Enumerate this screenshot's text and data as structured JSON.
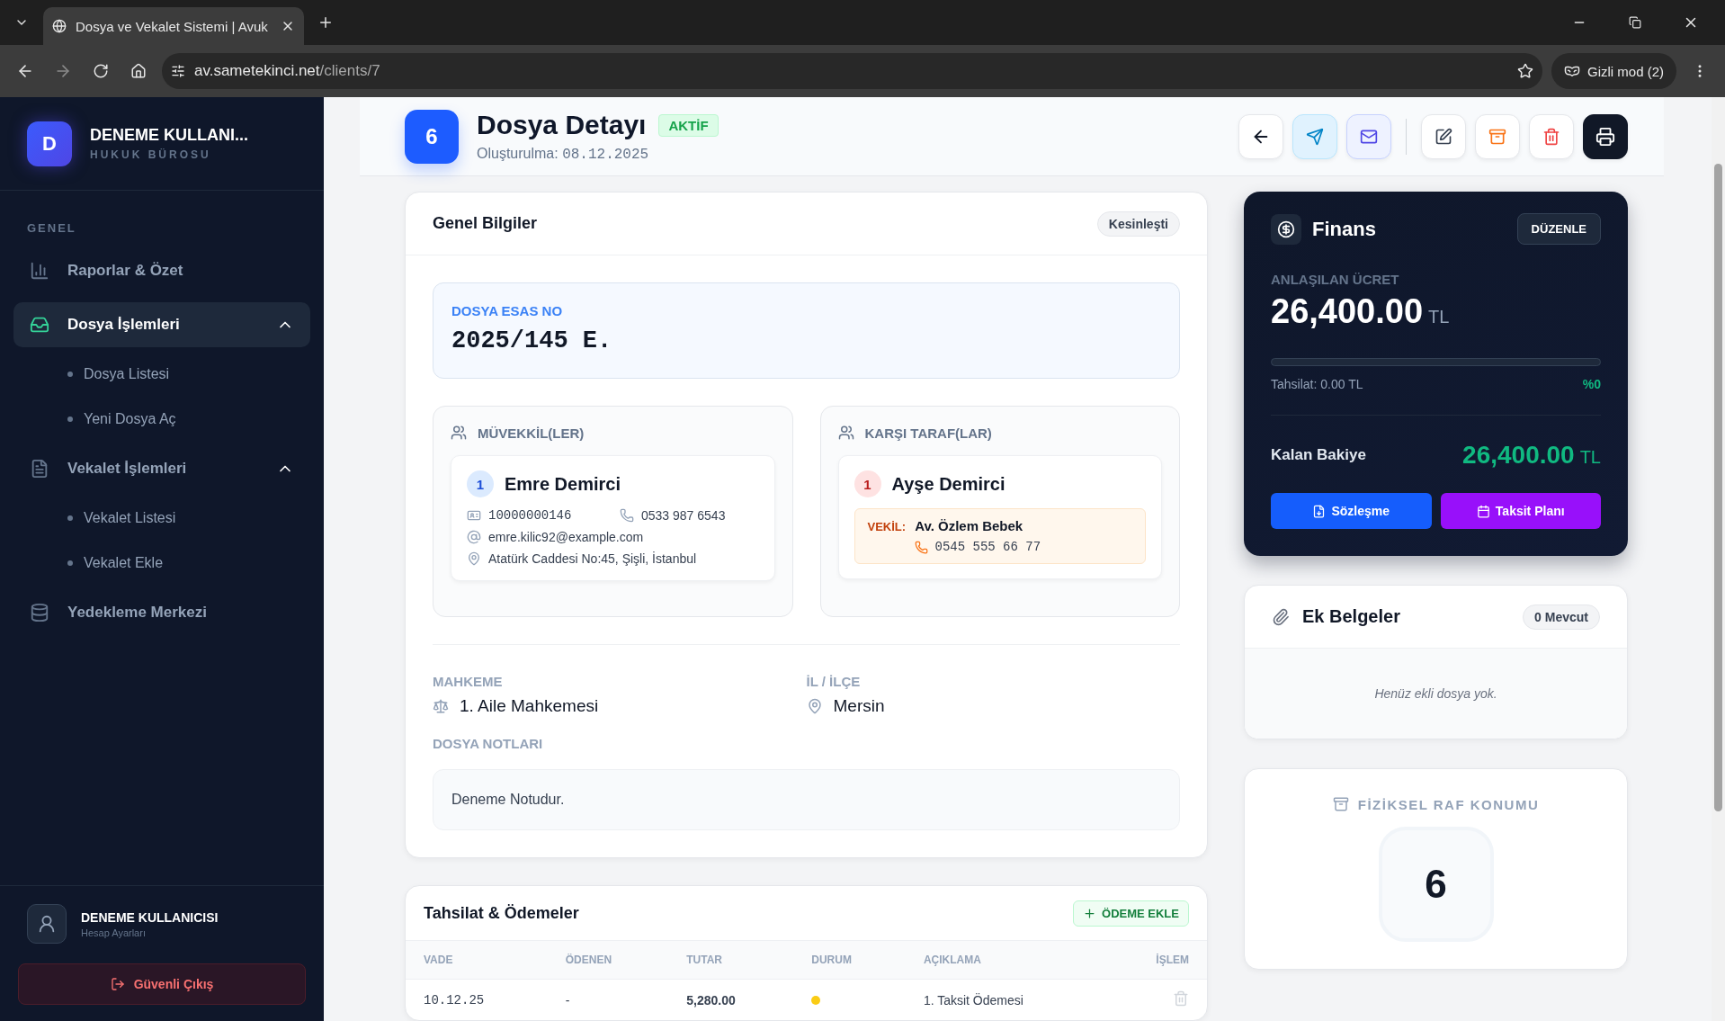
{
  "browser": {
    "tab_title": "Dosya ve Vekalet Sistemi | Avuk",
    "url_host": "av.sametekinci.net",
    "url_path": "/clients/7",
    "incognito": "Gizli mod (2)"
  },
  "sidebar": {
    "brand": {
      "initial": "D",
      "name": "DENEME KULLANI...",
      "subtitle": "HUKUK BÜROSU"
    },
    "section_label": "GENEL",
    "items": [
      {
        "label": "Raporlar & Özet",
        "kind": "link",
        "selected": false
      },
      {
        "label": "Dosya İşlemleri",
        "kind": "group",
        "selected": true,
        "expanded": true,
        "children": [
          {
            "label": "Dosya Listesi"
          },
          {
            "label": "Yeni Dosya Aç"
          }
        ]
      },
      {
        "label": "Vekalet İşlemleri",
        "kind": "group",
        "selected": false,
        "expanded": true,
        "children": [
          {
            "label": "Vekalet Listesi"
          },
          {
            "label": "Vekalet Ekle"
          }
        ]
      },
      {
        "label": "Yedekleme Merkezi",
        "kind": "link",
        "selected": false
      }
    ],
    "user": {
      "name": "DENEME KULLANICISI",
      "subtitle": "Hesap Ayarları"
    },
    "logout": "Güvenli Çıkış"
  },
  "header": {
    "badge": "6",
    "title": "Dosya Detayı",
    "status": "AKTİF",
    "created_label": "Oluşturulma:",
    "created_date": "08.12.2025"
  },
  "general": {
    "title": "Genel Bilgiler",
    "status_tag": "Kesinleşti",
    "case_no_label": "DOSYA ESAS NO",
    "case_no": "2025/145 E.",
    "clients": {
      "title": "MÜVEKKİL(LER)",
      "items": [
        {
          "index": "1",
          "name": "Emre Demirci",
          "id_no": "10000000146",
          "phone": "0533 987 6543",
          "email": "emre.kilic92@example.com",
          "address": "Atatürk Caddesi No:45, Şişli, İstanbul"
        }
      ]
    },
    "opponents": {
      "title": "KARŞI TARAF(LAR)",
      "items": [
        {
          "index": "1",
          "name": "Ayşe Demirci",
          "lawyer_label": "VEKİL:",
          "lawyer": "Av. Özlem Bebek",
          "lawyer_phone": "0545 555 66 77"
        }
      ]
    },
    "court_label": "MAHKEME",
    "court": "1. Aile Mahkemesi",
    "location_label": "İL / İLÇE",
    "location": "Mersin",
    "notes_label": "DOSYA NOTLARI",
    "notes": "Deneme Notudur."
  },
  "payments": {
    "title": "Tahsilat & Ödemeler",
    "add_button": "ÖDEME EKLE",
    "columns": [
      "VADE",
      "ÖDENEN",
      "TUTAR",
      "DURUM",
      "AÇIKLAMA",
      "İŞLEM"
    ],
    "rows": [
      {
        "due": "10.12.25",
        "paid": "-",
        "amount": "5,280.00",
        "color": "#facc15",
        "description": "1. Taksit Ödemesi"
      }
    ]
  },
  "finance": {
    "title": "Finans",
    "edit_button": "DÜZENLE",
    "fee_label": "ANLAŞILAN ÜCRET",
    "fee": "26,400.00",
    "currency": "TL",
    "level": 0,
    "collected": "Tahsilat: 0.00 TL",
    "percent": "%0",
    "balance_label": "Kalan Bakiye",
    "balance": "26,400.00",
    "balance_currency": "TL",
    "buttons": [
      {
        "label": "Sözleşme",
        "kind": "contract"
      },
      {
        "label": "Taksit Planı",
        "kind": "plan"
      }
    ]
  },
  "attachments": {
    "title": "Ek Belgeler",
    "count": "0 Mevcut",
    "empty": "Henüz ekli dosya yok."
  },
  "shelf": {
    "title": "FİZİKSEL RAF KONUMU",
    "value": "6"
  }
}
